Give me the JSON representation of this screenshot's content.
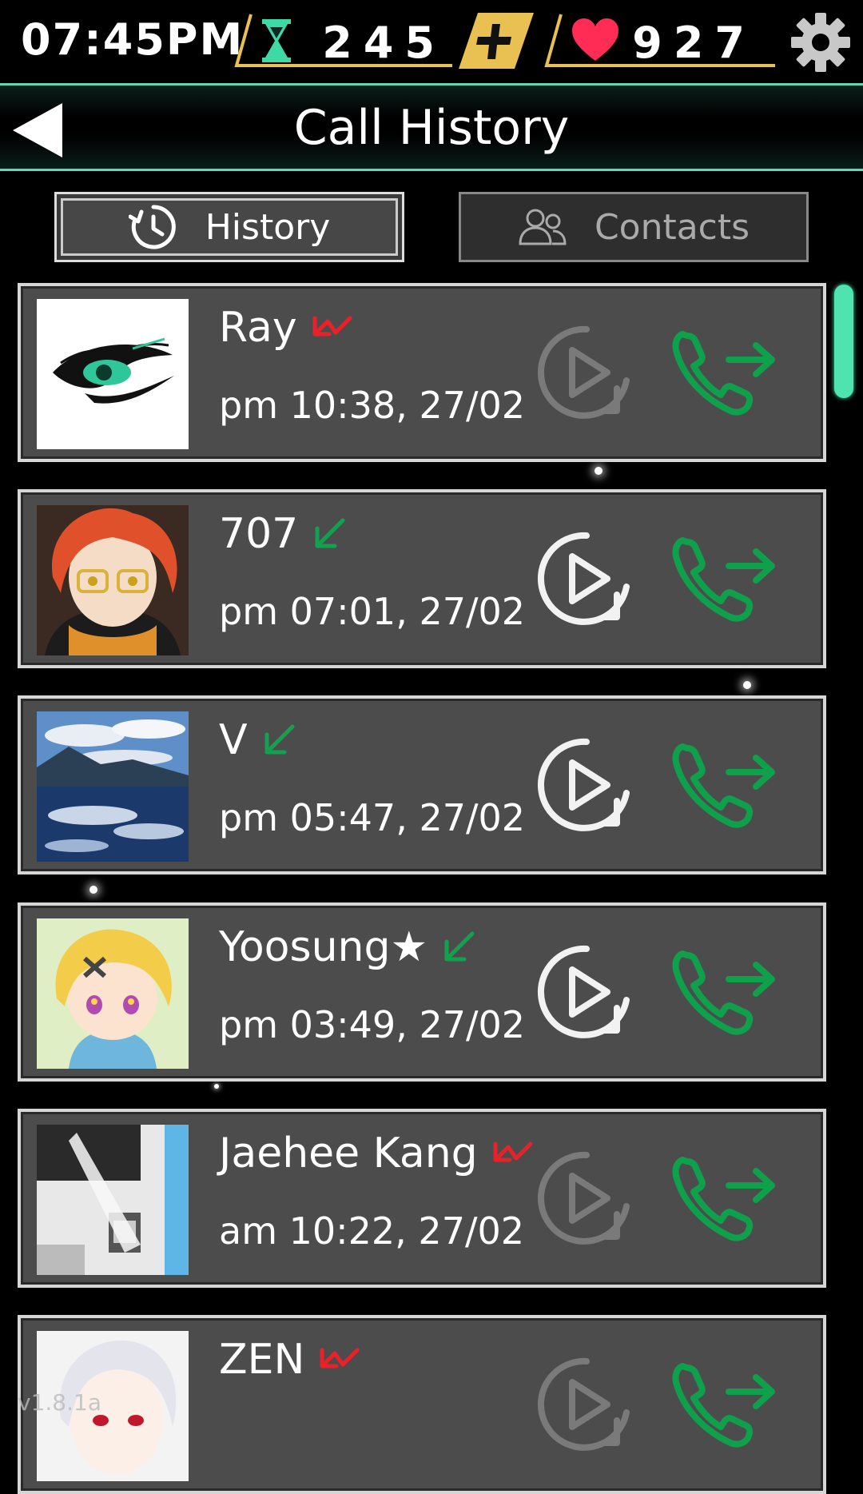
{
  "status": {
    "clock": "07:45PM",
    "hourglass_count": "245",
    "heart_count": "927",
    "icons": [
      "hourglass-icon",
      "plus-icon",
      "heart-icon",
      "gear-icon"
    ],
    "colors": {
      "frame": "#e8c152",
      "hourglass": "#3fd9a5",
      "heart": "#ff2d55"
    }
  },
  "header": {
    "title": "Call History",
    "accent": "#5fd9b4"
  },
  "tabs": [
    {
      "label": "History",
      "icon": "clock-icon",
      "active": true
    },
    {
      "label": "Contacts",
      "icon": "people-icon",
      "active": false
    }
  ],
  "calls": [
    {
      "name": "Ray",
      "time": "pm 10:38, 27/02",
      "status": "missed",
      "replay_available": false,
      "avatar": "mint-eye-logo"
    },
    {
      "name": "707",
      "time": "pm 07:01, 27/02",
      "status": "received",
      "replay_available": true,
      "avatar": "707-portrait"
    },
    {
      "name": "V",
      "time": "pm 05:47, 27/02",
      "status": "received",
      "replay_available": true,
      "avatar": "lake-landscape"
    },
    {
      "name": "Yoosung★",
      "time": "pm 03:49, 27/02",
      "status": "received",
      "replay_available": true,
      "avatar": "yoosung-portrait"
    },
    {
      "name": "Jaehee Kang",
      "time": "am 10:22, 27/02",
      "status": "missed",
      "replay_available": false,
      "avatar": "coffee-machine"
    },
    {
      "name": "ZEN",
      "time": "",
      "status": "missed",
      "replay_available": false,
      "avatar": "zen-portrait"
    }
  ],
  "call_colors": {
    "missed": "#e8222b",
    "received": "#13a150",
    "call_button": "#0fa04c"
  },
  "watermark": "v1.8.1a"
}
